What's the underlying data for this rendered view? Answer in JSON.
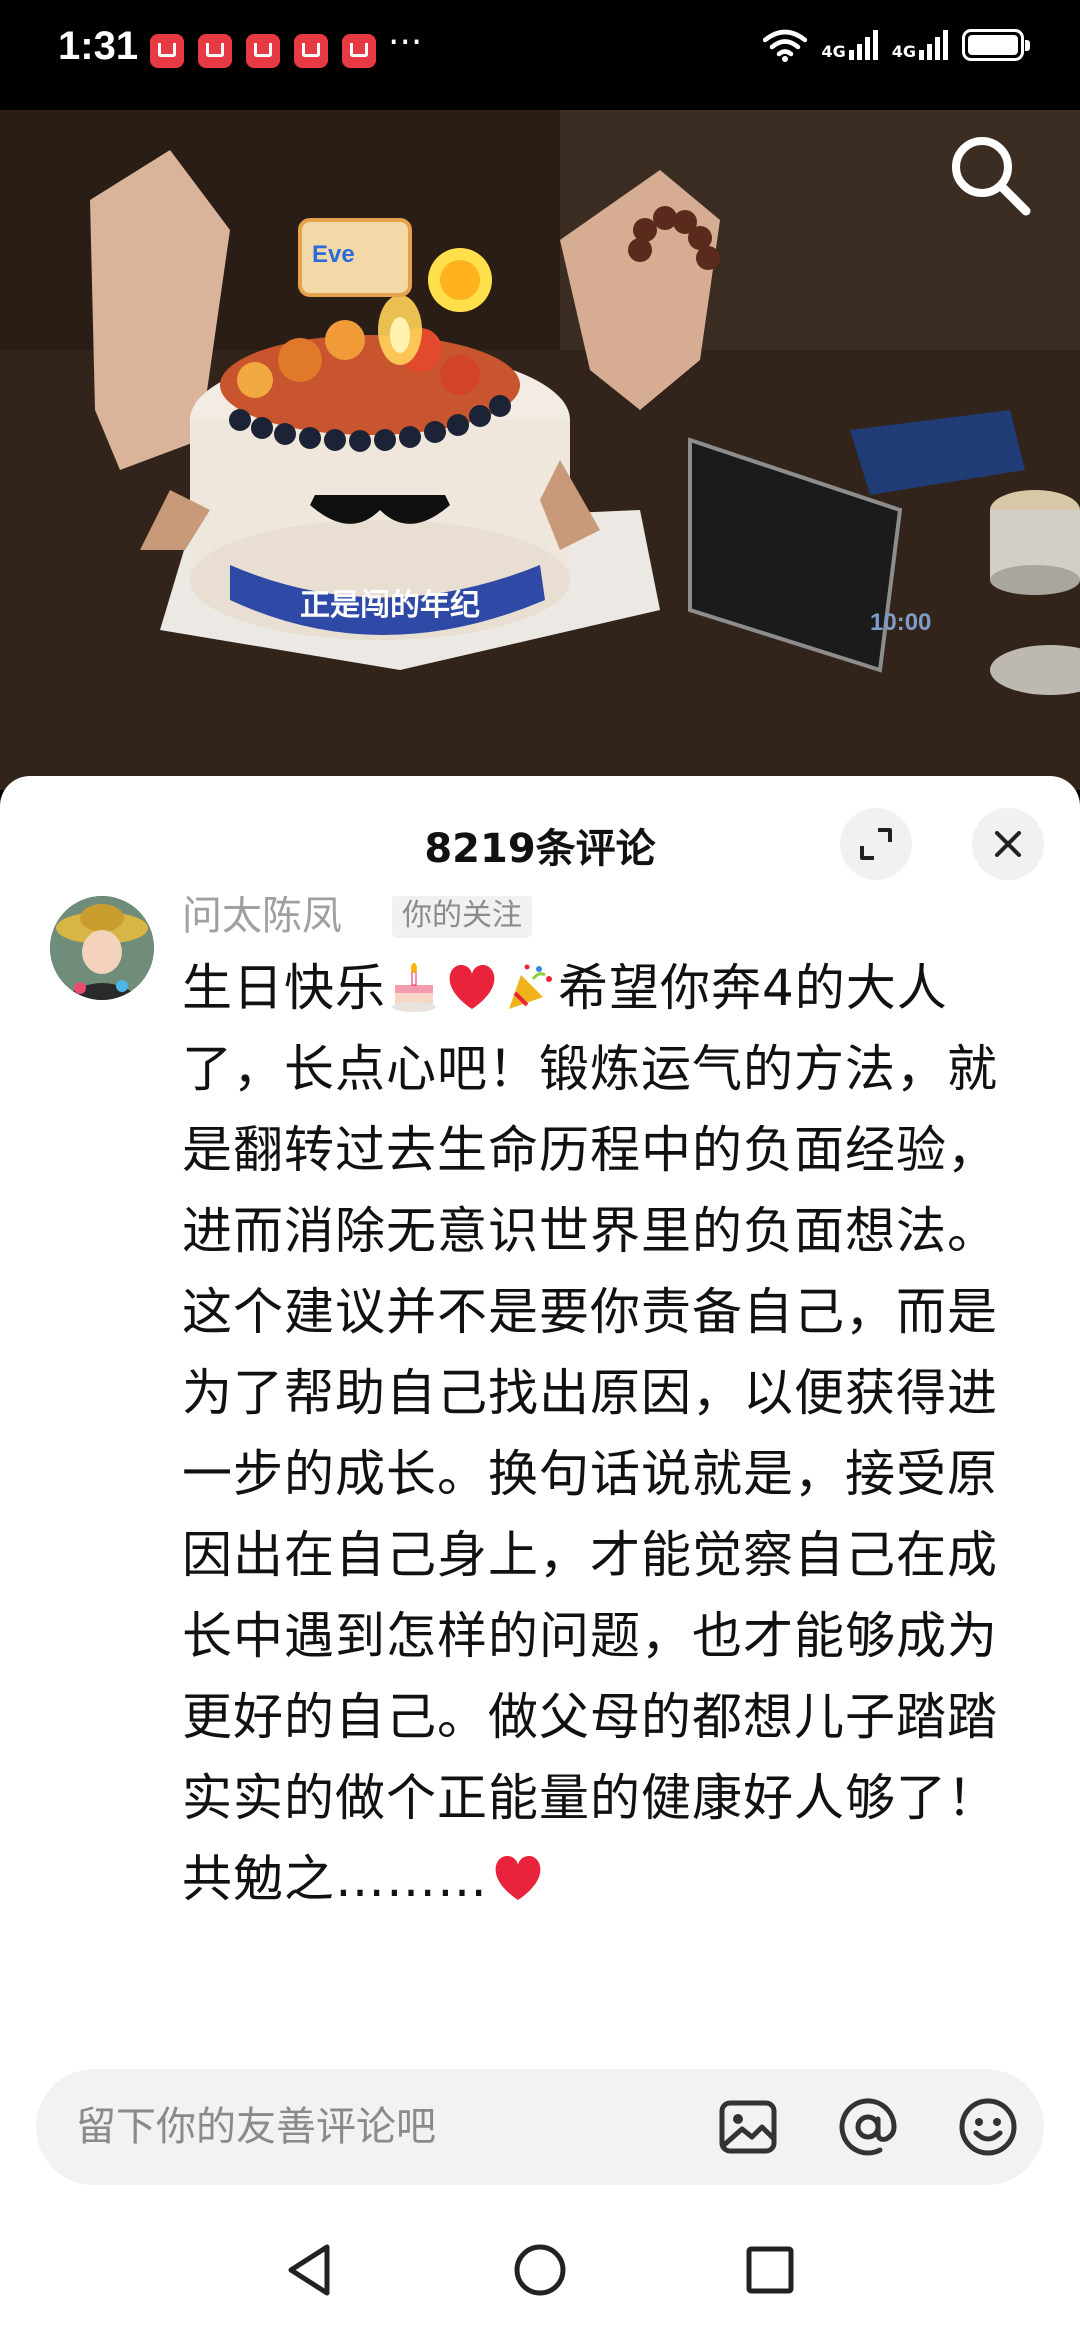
{
  "status_bar": {
    "time": "1:31",
    "more": "···",
    "signal_1": "4G",
    "signal_2": "4G"
  },
  "photo": {
    "cake_ribbon_text": "正是闯的年纪",
    "cake_topper_text": "Eve",
    "phone_clock": "10:00"
  },
  "sheet": {
    "title": "8219条评论"
  },
  "comment": {
    "author": "问太陈凤",
    "badge": "你的关注",
    "text_1": "生日快乐",
    "text_2": "希望你奔4的大人了，长点心吧！锻炼运气的方法，就是翻转过去生命历程中的负面经验，进而消除无意识世界里的负面想法。这个建议并不是要你责备自己，而是为了帮助自己找出原因，以便获得进一步的成长。换句话说就是，接受原因出在自己身上，才能觉察自己在成长中遇到怎样的问题，也才能够成为更好的自己。做父母的都想儿子踏踏实实的做个正能量的健康好人够了！共勉之………"
  },
  "input": {
    "placeholder": "留下你的友善评论吧"
  },
  "icons": {
    "search": "search-icon",
    "expand": "expand-icon",
    "close": "close-icon",
    "image": "image-icon",
    "mention": "at-icon",
    "emoji": "smiley-icon",
    "back": "back-triangle-icon",
    "home": "home-circle-icon",
    "recents": "recents-square-icon"
  },
  "colors": {
    "heart": "#e8233b",
    "notification": "#e83a45",
    "sheet_bg": "#ffffff",
    "muted_text": "#a0a0a0"
  }
}
